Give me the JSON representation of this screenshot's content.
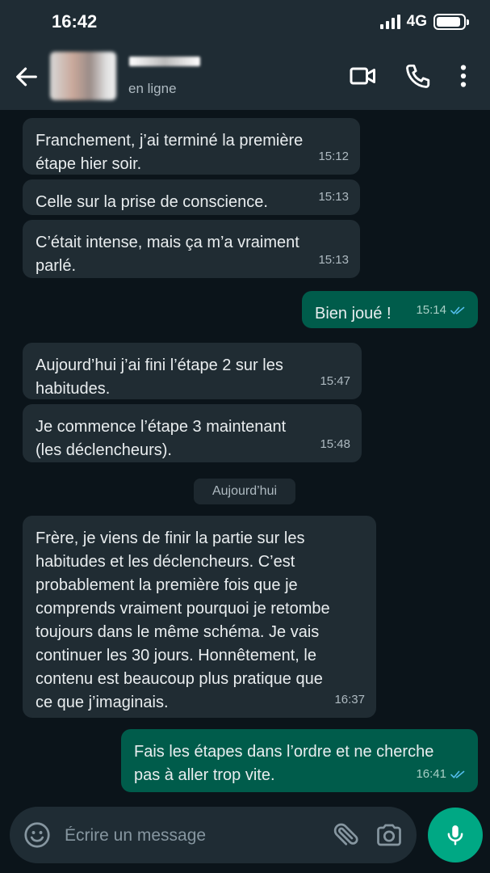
{
  "status_bar": {
    "time": "16:42",
    "network": "4G",
    "battery_level": 0.9
  },
  "header": {
    "contact_status": "en ligne"
  },
  "messages": [
    {
      "direction": "in",
      "text": "Franchement, j’ai terminé la première\nétape hier soir.",
      "time": "15:12"
    },
    {
      "direction": "in",
      "text": "Celle sur la prise de conscience.",
      "time": "15:13"
    },
    {
      "direction": "in",
      "text": "C’était intense, mais ça m’a vraiment\nparlé.",
      "time": "15:13"
    },
    {
      "direction": "out",
      "text": "Bien joué !",
      "time": "15:14",
      "status": "read"
    },
    {
      "direction": "in",
      "text": "Aujourd’hui j’ai fini l’étape 2 sur les\nhabitudes.",
      "time": "15:47"
    },
    {
      "direction": "in",
      "text": "Je commence l’étape 3 maintenant\n(les déclencheurs).",
      "time": "15:48"
    },
    {
      "direction": "in",
      "text": "Frère, je viens de finir la partie sur les\nhabitudes et les déclencheurs. C’est\nprobablement la première fois que je\ncomprends vraiment pourquoi je retombe\ntoujours dans le même schéma. Je vais\ncontinuer les 30 jours. Honnêtement, le\ncontenu est beaucoup plus pratique que\nce que j’imaginais.",
      "time": "16:37"
    },
    {
      "direction": "out",
      "text": "Fais les étapes dans l’ordre et ne cherche\npas à aller trop vite.",
      "time": "16:41",
      "status": "read"
    }
  ],
  "date_separator": "Aujourd’hui",
  "composer": {
    "placeholder": "Écrire un message"
  },
  "colors": {
    "background": "#0b141a",
    "header": "#1f2c34",
    "incoming_bubble": "#202c33",
    "outgoing_bubble": "#005c4b",
    "accent": "#00a884",
    "read_ticks": "#53bdeb"
  },
  "icons": {
    "back": "arrow-left-icon",
    "video": "video-camera-icon",
    "call": "phone-icon",
    "menu": "more-vertical-icon",
    "emoji": "smiley-icon",
    "attach": "paperclip-icon",
    "camera": "camera-icon",
    "mic": "microphone-icon"
  }
}
